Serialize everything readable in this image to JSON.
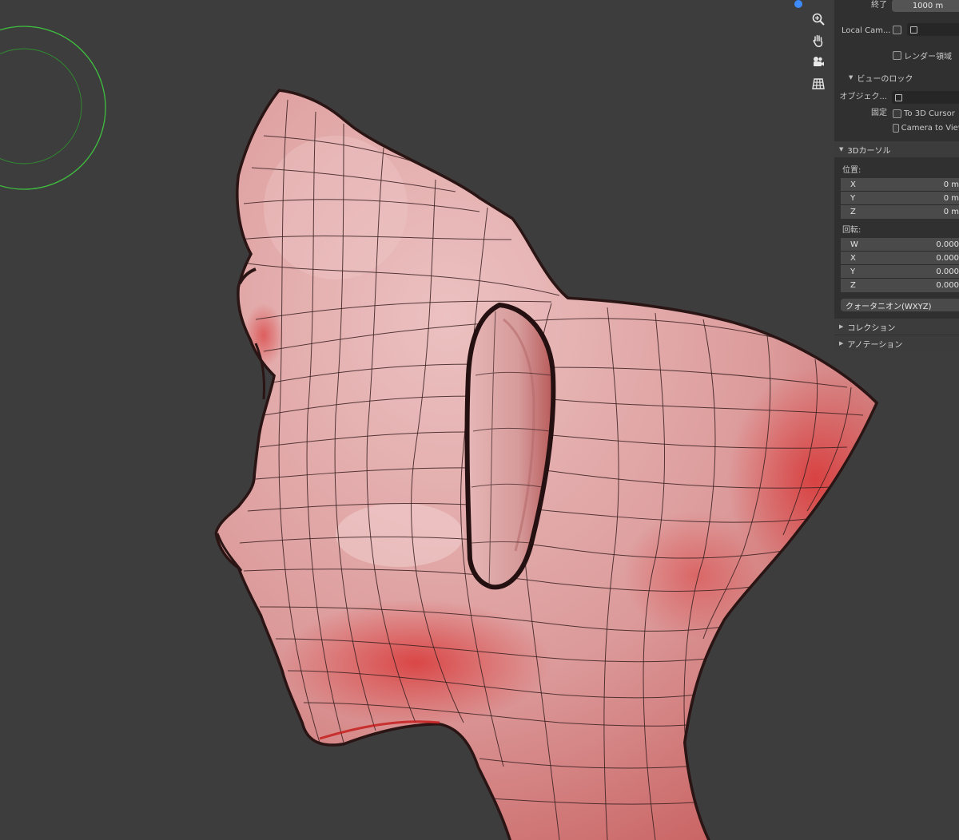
{
  "clip_end": {
    "label": "終了",
    "value": "1000 m"
  },
  "local_camera": {
    "label": "Local Cam..."
  },
  "render_region": {
    "label": "レンダー領域"
  },
  "view_lock": {
    "header": "ビューのロック",
    "object_label": "オブジェク...",
    "lock_label": "固定",
    "to_3d_cursor": "To 3D Cursor",
    "camera_to_view": "Camera to View"
  },
  "cursor_3d": {
    "header": "3Dカーソル",
    "location_label": "位置:",
    "location": [
      {
        "axis": "X",
        "value": "0 m"
      },
      {
        "axis": "Y",
        "value": "0 m"
      },
      {
        "axis": "Z",
        "value": "0 m"
      }
    ],
    "rotation_label": "回転:",
    "rotation": [
      {
        "axis": "W",
        "value": "0.000"
      },
      {
        "axis": "X",
        "value": "0.000"
      },
      {
        "axis": "Y",
        "value": "0.000"
      },
      {
        "axis": "Z",
        "value": "0.000"
      }
    ],
    "rotation_mode": "クォータニオン(WXYZ)"
  },
  "collapsed_panels": [
    {
      "label": "コレクション"
    },
    {
      "label": "アノテーション"
    }
  ],
  "nav_gizmo": [
    "zoom-icon",
    "hand-pan-icon",
    "camera-icon",
    "grid-icon"
  ],
  "colors": {
    "viewport_bg": "#3d3d3d",
    "sidebar_bg": "#303030",
    "mesh_base": "#e2a3a3",
    "mesh_shadow": "#d13232",
    "light_circle": "#3fbf3f",
    "accent_dot": "#3e8bff"
  }
}
